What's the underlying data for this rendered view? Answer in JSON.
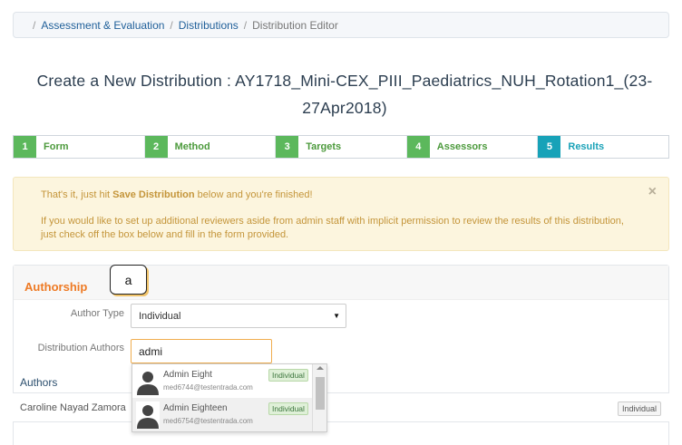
{
  "breadcrumb": {
    "separator": "/",
    "items": [
      "Assessment & Evaluation",
      "Distributions"
    ],
    "current": "Distribution Editor"
  },
  "page_title": {
    "line1": "Create a New Distribution : AY1718_Mini-CEX_PIII_Paediatrics_NUH_Rotation1_(23-",
    "line2": "27Apr2018)"
  },
  "steps": [
    {
      "number": "1",
      "label": "Form",
      "state": "complete"
    },
    {
      "number": "2",
      "label": "Method",
      "state": "complete"
    },
    {
      "number": "3",
      "label": "Targets",
      "state": "complete"
    },
    {
      "number": "4",
      "label": "Assessors",
      "state": "complete"
    },
    {
      "number": "5",
      "label": "Results",
      "state": "active"
    }
  ],
  "alert": {
    "line1_pre": "That's it, just hit ",
    "line1_bold": "Save Distribution",
    "line1_post": " below and you're finished!",
    "line2": "If you would like to set up additional reviewers aside from admin staff with implicit permission to review the results of this distribution, just check off the box below and fill in the form provided.",
    "close": "×"
  },
  "authorship": {
    "title": "Authorship",
    "callout": "a",
    "author_type_label": "Author Type",
    "author_type_value": "Individual",
    "distribution_authors_label": "Distribution Authors",
    "distribution_authors_value": "admi",
    "authors_heading": "Authors",
    "authors": [
      {
        "name": "Caroline Nayad Zamora",
        "type": "Individual"
      }
    ],
    "suggestions": [
      {
        "name": "Admin Eight",
        "email": "med6744@testentrada.com",
        "type": "Individual"
      },
      {
        "name": "Admin Eighteen",
        "email": "med6754@testentrada.com",
        "type": "Individual"
      }
    ]
  },
  "colors": {
    "step_complete": "#5cb85c",
    "step_active": "#17a2b8",
    "alert_bg": "#fcf5de",
    "alert_text": "#c4953a",
    "panel_title": "#ee7a24",
    "link": "#1f5f99"
  }
}
